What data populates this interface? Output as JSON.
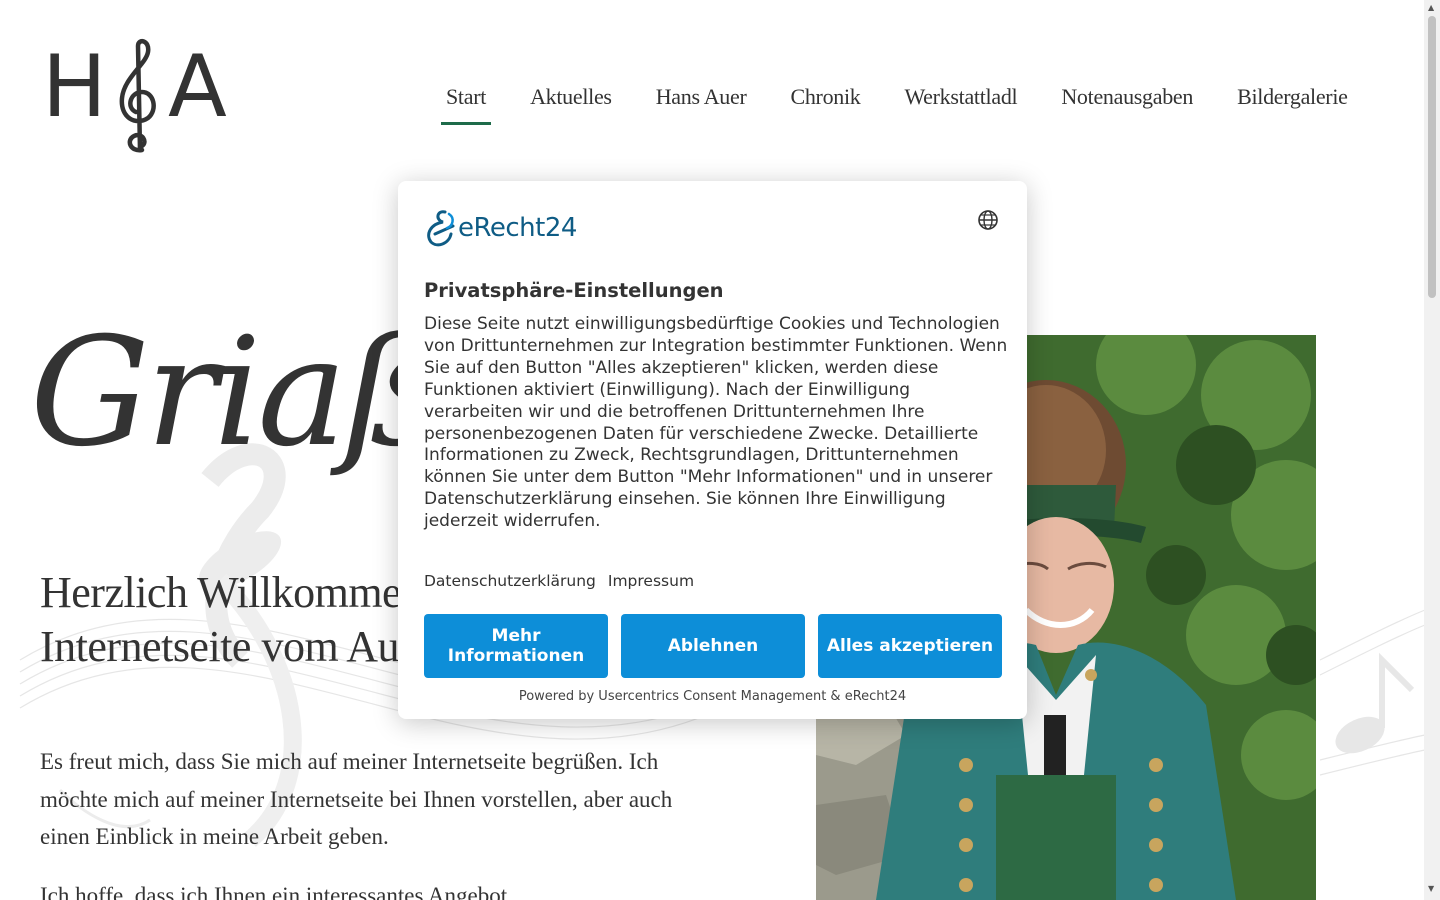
{
  "header": {
    "logo_letter_left": "H",
    "logo_letter_right": "A",
    "nav": [
      {
        "label": "Start",
        "active": true
      },
      {
        "label": "Aktuelles",
        "active": false
      },
      {
        "label": "Hans Auer",
        "active": false
      },
      {
        "label": "Chronik",
        "active": false
      },
      {
        "label": "Werkstattladl",
        "active": false
      },
      {
        "label": "Notenausgaben",
        "active": false
      },
      {
        "label": "Bildergalerie",
        "active": false
      }
    ]
  },
  "main": {
    "script_heading": "Griaß",
    "welcome_heading": "Herzlich Willkommen auf der Internetseite vom Auer Hans",
    "intro_paragraph": "Es freut mich, dass Sie mich auf meiner Internetseite begrüßen. Ich möchte mich auf meiner Internetseite bei Ihnen vorstellen, aber auch einen Einblick in meine Arbeit geben.",
    "second_paragraph": "Ich hoffe, dass ich Ihnen ein interessantes Angebot"
  },
  "consent": {
    "brand": "eRecht24",
    "title": "Privatsphäre-Einstellungen",
    "text": "Diese Seite nutzt einwilligungsbedürftige Cookies und Technologien von Drittunternehmen zur Integration bestimmter Funktionen. Wenn Sie auf den Button \"Alles akzeptieren\" klicken, werden diese Funktionen aktiviert (Einwilligung). Nach der Einwilligung verarbeiten wir und die betroffenen Drittunternehmen Ihre personenbezogenen Daten für verschiedene Zwecke. Detaillierte Informationen zu Zweck, Rechtsgrundlagen, Drittunternehmen können Sie unter dem Button \"Mehr Informationen\" und in unserer Datenschutzerklärung einsehen. Sie können Ihre Einwilligung jederzeit widerrufen.",
    "links": [
      "Datenschutzerklärung",
      "Impressum"
    ],
    "buttons": {
      "more": "Mehr Informationen",
      "decline": "Ablehnen",
      "accept": "Alles akzeptieren"
    },
    "powered_by": "Powered by Usercentrics Consent Management & eRecht24"
  },
  "colors": {
    "nav_active_underline": "#1e6b4a",
    "button_blue": "#0d8ed8",
    "brand_teal": "#0f5c85",
    "text": "#333333"
  },
  "icons": {
    "language": "globe-icon",
    "logo_mark": "treble-clef-icon",
    "scroll_up": "arrow-up-icon",
    "scroll_down": "arrow-down-icon"
  }
}
